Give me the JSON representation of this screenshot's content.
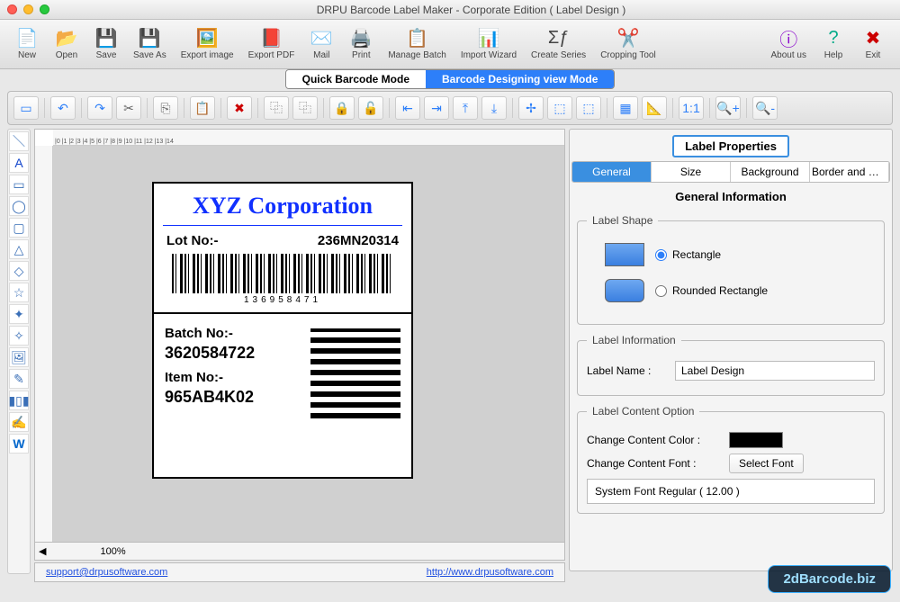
{
  "window": {
    "title": "DRPU Barcode Label Maker - Corporate Edition ( Label Design )"
  },
  "toolbar": {
    "new": "New",
    "open": "Open",
    "save": "Save",
    "saveas": "Save As",
    "exportimg": "Export image",
    "exportpdf": "Export PDF",
    "mail": "Mail",
    "print": "Print",
    "batch": "Manage Batch",
    "import": "Import Wizard",
    "series": "Create Series",
    "crop": "Cropping Tool",
    "about": "About us",
    "help": "Help",
    "exit": "Exit"
  },
  "modes": {
    "quick": "Quick Barcode Mode",
    "design": "Barcode Designing view Mode"
  },
  "ruler": "|0    |1    |2    |3    |4    |5    |6    |7    |8    |9    |10    |11    |12    |13    |14",
  "label": {
    "company": "XYZ Corporation",
    "lot_label": "Lot No:-",
    "lot_value": "236MN20314",
    "barcode_number": "136958471",
    "batch_label": "Batch No:-",
    "batch_value": "3620584722",
    "item_label": "Item No:-",
    "item_value": "965AB4K02"
  },
  "zoom": "100%",
  "links": {
    "email": "support@drpusoftware.com",
    "site": "http://www.drpusoftware.com"
  },
  "props": {
    "title": "Label Properties",
    "tabs": {
      "general": "General",
      "size": "Size",
      "bg": "Background",
      "border": "Border and Wa..."
    },
    "section": "General Information",
    "shape_legend": "Label Shape",
    "shape_rect": "Rectangle",
    "shape_rrect": "Rounded Rectangle",
    "info_legend": "Label Information",
    "name_label": "Label Name :",
    "name_value": "Label Design",
    "content_legend": "Label Content Option",
    "color_label": "Change Content Color :",
    "font_label": "Change Content Font :",
    "font_btn": "Select Font",
    "font_current": "System Font Regular ( 12.00 )"
  },
  "watermark": "2dBarcode.biz"
}
